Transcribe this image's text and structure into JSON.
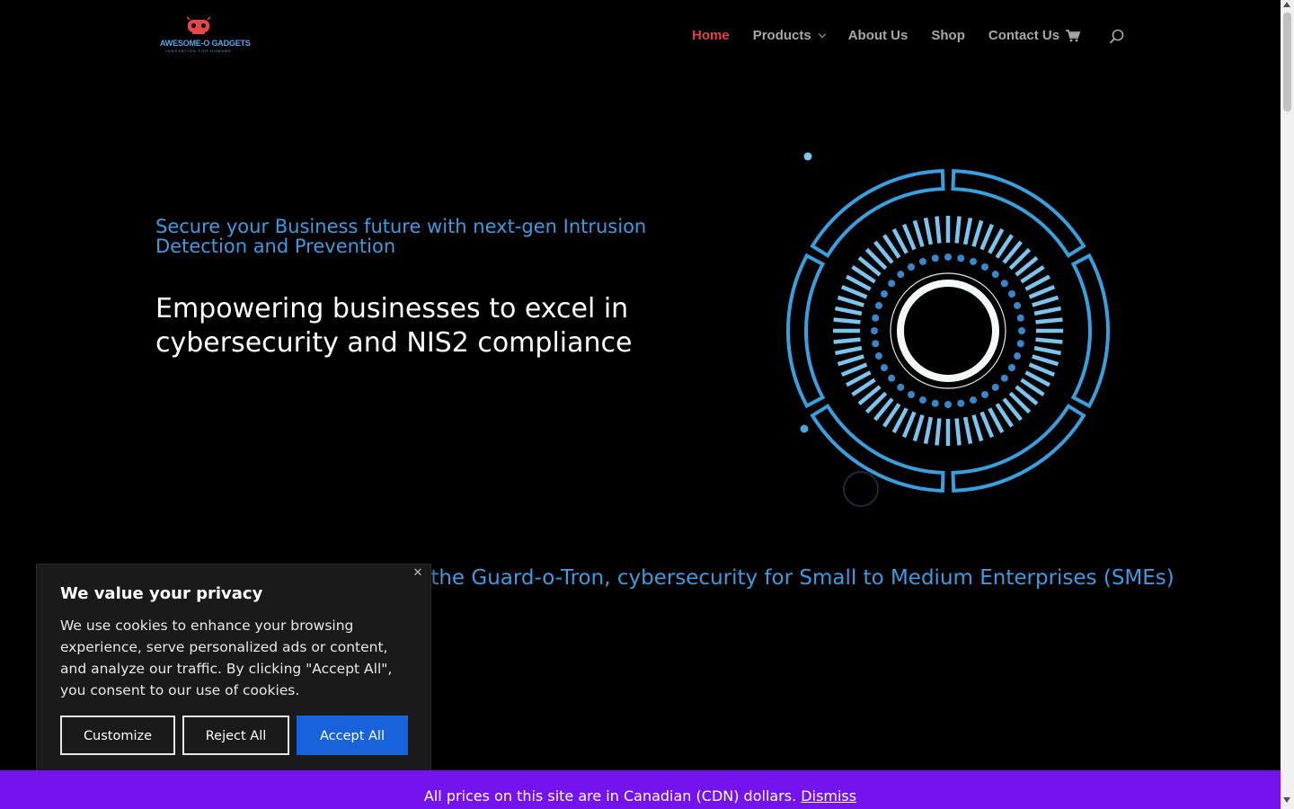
{
  "brand": {
    "logo_name": "AWESOME-O GADGETS",
    "logo_tagline": "INNOVATION FOR HUMANS",
    "accent": "#3d9be0",
    "active_nav": "#e0443e",
    "notice_bg": "#7413ee",
    "accept_bg": "#1863dc"
  },
  "nav": {
    "home": "Home",
    "products": "Products",
    "about": "About Us",
    "shop": "Shop",
    "contact": "Contact Us",
    "cart_icon": "cart-icon",
    "search_icon": "search-icon"
  },
  "hero": {
    "kicker": "Secure your Business future with next-gen Intrusion Detection and Prevention",
    "headline": "Empowering businesses to excel in cybersecurity and NIS2 compliance",
    "tagline": "Protect your business with the Guard-o-Tron, cybersecurity for Small to Medium Enterprises (SMEs)"
  },
  "cookie": {
    "title": "We value your privacy",
    "body": "We use cookies to enhance your browsing experience, serve personalized ads or content, and analyze our traffic. By clicking \"Accept All\", you consent to our use of cookies.",
    "close": "✕",
    "customize": "Customize",
    "reject": "Reject All",
    "accept": "Accept All"
  },
  "notice": {
    "text": "All prices on this site are in Canadian (CDN) dollars.",
    "dismiss": "Dismiss"
  }
}
